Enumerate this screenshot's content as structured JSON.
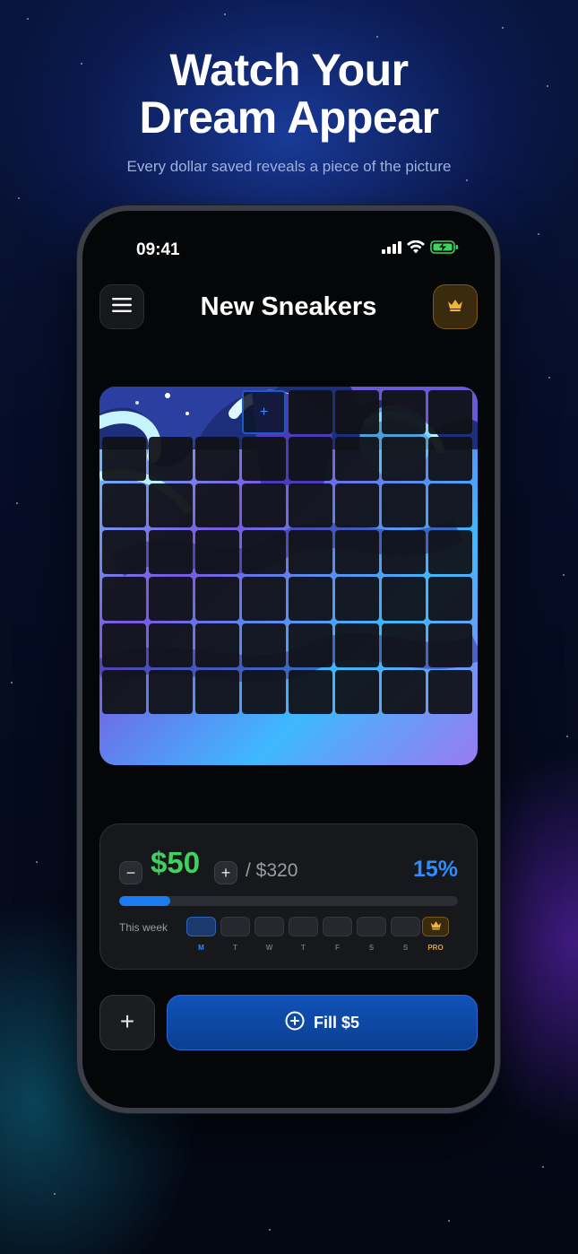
{
  "hero": {
    "line1": "Watch Your",
    "line2": "Dream Appear",
    "subtitle": "Every dollar saved reveals a piece of the picture"
  },
  "status_bar": {
    "time": "09:41"
  },
  "header": {
    "title": "New Sneakers"
  },
  "puzzle": {
    "columns": 8,
    "rows": 7,
    "revealed_tiles": 3,
    "next_tile_symbol": "+"
  },
  "savings": {
    "saved": "$50",
    "goal": "/ $320",
    "percent": "15%",
    "progress": 0.15,
    "decrease_symbol": "−",
    "increase_symbol": "+"
  },
  "week": {
    "label": "This week",
    "days": [
      "M",
      "T",
      "W",
      "T",
      "F",
      "S",
      "S"
    ],
    "pro_label": "PRO",
    "active_day_index": 0
  },
  "actions": {
    "add_symbol": "+",
    "fill_label": "Fill $5"
  },
  "colors": {
    "accent": "#2d8cff",
    "saved_green": "#3fd35e",
    "pro_gold": "#e0a530"
  },
  "icons": {
    "menu": "hamburger-icon",
    "premium": "crown-icon",
    "fill": "plus-circle-icon",
    "signal": "signal-icon",
    "wifi": "wifi-icon",
    "battery": "battery-charging-icon"
  }
}
